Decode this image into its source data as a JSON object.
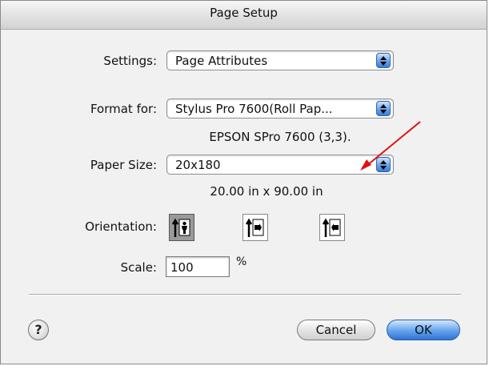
{
  "window": {
    "title": "Page Setup"
  },
  "settings": {
    "label": "Settings:",
    "value": "Page Attributes"
  },
  "format_for": {
    "label": "Format for:",
    "value": "Stylus Pro 7600(Roll Pap...",
    "printer_info": "EPSON SPro 7600 (3,3)."
  },
  "paper_size": {
    "label": "Paper Size:",
    "value": "20x180",
    "dimensions": "20.00 in x 90.00 in"
  },
  "orientation": {
    "label": "Orientation:",
    "options": [
      {
        "name": "portrait",
        "selected": true
      },
      {
        "name": "landscape-left",
        "selected": false
      },
      {
        "name": "landscape-right",
        "selected": false
      }
    ]
  },
  "scale": {
    "label": "Scale:",
    "value": "100",
    "unit": "%"
  },
  "buttons": {
    "help": "?",
    "cancel": "Cancel",
    "ok": "OK"
  },
  "colors": {
    "accent_blue": "#3b7ed6",
    "annotation_red": "#e01010"
  },
  "icons": [
    "chevron-updown-icon",
    "portrait-icon",
    "landscape-left-icon",
    "landscape-right-icon",
    "help-icon",
    "red-arrow-annotation"
  ]
}
